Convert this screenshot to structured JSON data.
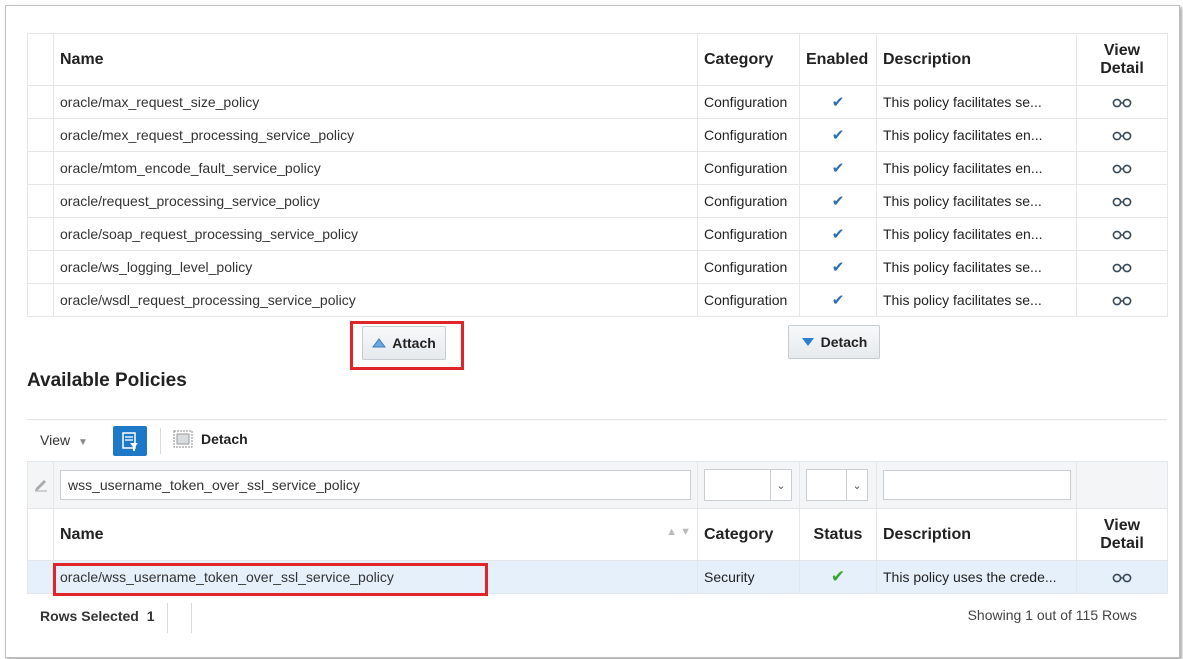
{
  "attached": {
    "columns": {
      "name": "Name",
      "category": "Category",
      "enabled": "Enabled",
      "description": "Description",
      "view_detail_line1": "View",
      "view_detail_line2": "Detail"
    },
    "rows": [
      {
        "name": "oracle/max_request_size_policy",
        "category": "Configuration",
        "enabled": "✔",
        "description": "This policy facilitates se..."
      },
      {
        "name": "oracle/mex_request_processing_service_policy",
        "category": "Configuration",
        "enabled": "✔",
        "description": "This policy facilitates en..."
      },
      {
        "name": "oracle/mtom_encode_fault_service_policy",
        "category": "Configuration",
        "enabled": "✔",
        "description": "This policy facilitates en..."
      },
      {
        "name": "oracle/request_processing_service_policy",
        "category": "Configuration",
        "enabled": "✔",
        "description": "This policy facilitates se..."
      },
      {
        "name": "oracle/soap_request_processing_service_policy",
        "category": "Configuration",
        "enabled": "✔",
        "description": "This policy facilitates en..."
      },
      {
        "name": "oracle/ws_logging_level_policy",
        "category": "Configuration",
        "enabled": "✔",
        "description": "This policy facilitates se..."
      },
      {
        "name": "oracle/wsdl_request_processing_service_policy",
        "category": "Configuration",
        "enabled": "✔",
        "description": "This policy facilitates se..."
      }
    ]
  },
  "buttons": {
    "attach": "Attach",
    "detach": "Detach"
  },
  "available": {
    "heading": "Available Policies",
    "toolbar": {
      "view_label": "View",
      "detach_label": "Detach"
    },
    "filter": {
      "name_value": "wss_username_token_over_ssl_service_policy"
    },
    "columns": {
      "name": "Name",
      "category": "Category",
      "status": "Status",
      "description": "Description",
      "view_detail_line1": "View",
      "view_detail_line2": "Detail"
    },
    "rows": [
      {
        "name": "oracle/wss_username_token_over_ssl_service_policy",
        "category": "Security",
        "status": "✔",
        "description": "This policy uses the crede..."
      }
    ],
    "footer": {
      "rows_selected_label": "Rows Selected",
      "rows_selected_count": "1",
      "showing": "Showing 1 out of 115 Rows"
    }
  },
  "colors": {
    "highlight_red": "#e1232a",
    "filter_blue": "#1e78c8",
    "check_blue": "#2c6fb5",
    "status_green": "#3aa335",
    "selected_row": "#e5f0fa"
  },
  "icons": {
    "attach": "triangle-up-icon",
    "detach": "triangle-down-icon",
    "view_detail": "glasses-icon",
    "filter": "query-filter-icon",
    "toolbar_detach": "detach-window-icon",
    "edit": "pencil-icon",
    "sort": "sort-arrows-icon"
  }
}
